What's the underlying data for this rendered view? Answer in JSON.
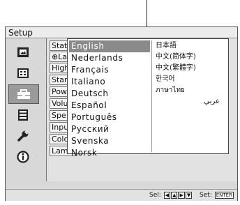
{
  "window": {
    "title": "Setup"
  },
  "tabs": [
    {
      "icon": "picture-icon"
    },
    {
      "icon": "screen-icon"
    },
    {
      "icon": "setup-toolbox-icon",
      "active": true
    },
    {
      "icon": "menu-list-icon"
    },
    {
      "icon": "wrench-icon"
    },
    {
      "icon": "info-icon"
    }
  ],
  "settings": {
    "rows": [
      {
        "label": "Stat"
      },
      {
        "label": "⊕La"
      },
      {
        "label": "High"
      },
      {
        "label": "Stan"
      },
      {
        "label": "Pow"
      },
      {
        "label": "Volu"
      },
      {
        "label": "Spe"
      },
      {
        "label": "Inpu"
      },
      {
        "label": "Colo"
      },
      {
        "label": "Lam"
      }
    ]
  },
  "language_menu": {
    "left": [
      "English",
      "Nederlands",
      "Français",
      "Italiano",
      "Deutsch",
      "Español",
      "Português",
      "Русский",
      "Svenska",
      "Norsk"
    ],
    "right": [
      "日本語",
      "中文(简体字)",
      "中文(繁體字)",
      "한국어",
      "ภาษาไทย",
      "عربي"
    ],
    "selected": "English"
  },
  "footer": {
    "sel_label": "Sel:",
    "set_label": "Set:",
    "enter_key": "ENTER"
  },
  "colors": {
    "highlight": "#8a8a8a",
    "panel": "#d8d8d8",
    "popup": "#ffffff"
  }
}
